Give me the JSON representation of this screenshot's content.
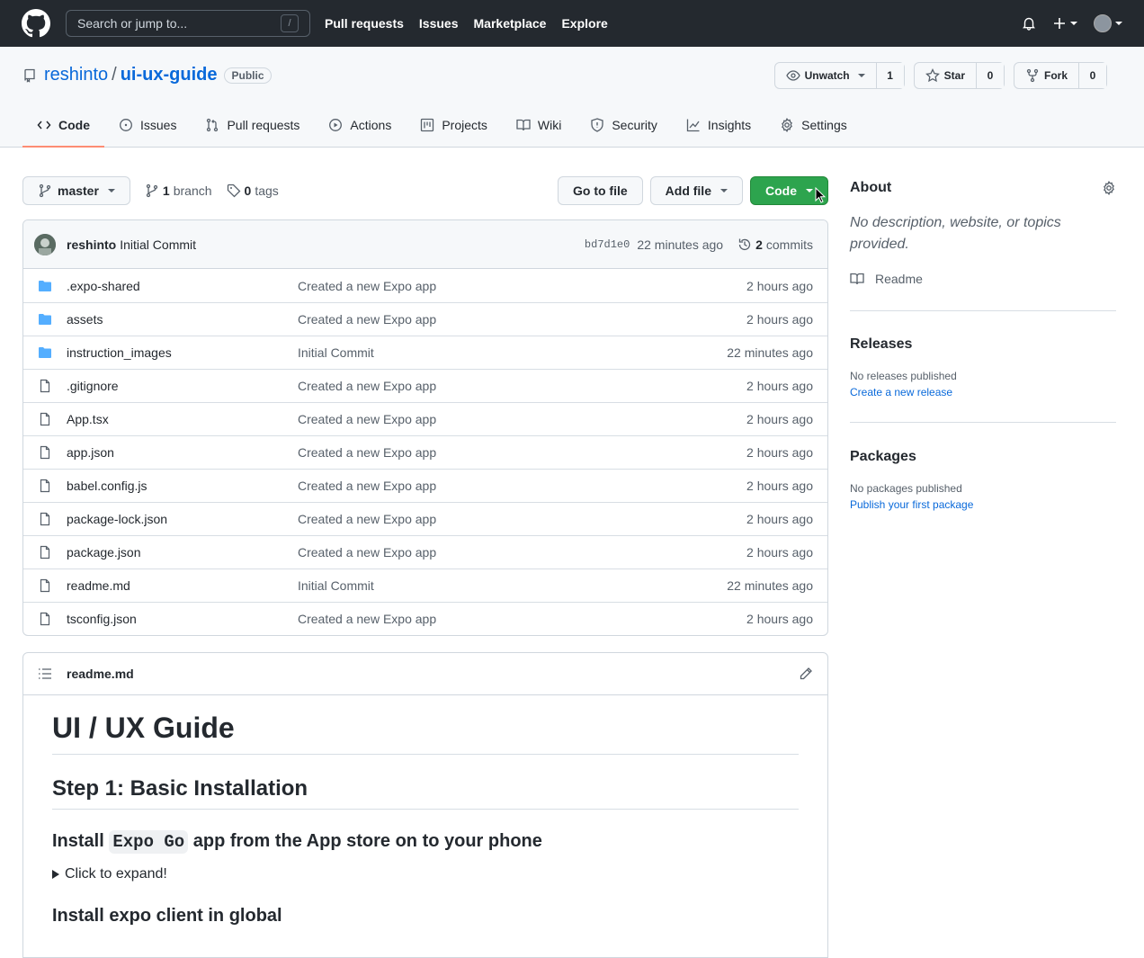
{
  "header": {
    "search_placeholder": "Search or jump to...",
    "search_shortcut": "/",
    "nav": [
      "Pull requests",
      "Issues",
      "Marketplace",
      "Explore"
    ]
  },
  "repo": {
    "owner": "reshinto",
    "separator": "/",
    "name": "ui-ux-guide",
    "visibility": "Public",
    "watch_label": "Unwatch",
    "watch_count": "1",
    "star_label": "Star",
    "star_count": "0",
    "fork_label": "Fork",
    "fork_count": "0",
    "tabs": [
      "Code",
      "Issues",
      "Pull requests",
      "Actions",
      "Projects",
      "Wiki",
      "Security",
      "Insights",
      "Settings"
    ]
  },
  "toolbar": {
    "branch": "master",
    "branch_count": "1",
    "branch_label": "branch",
    "tag_count": "0",
    "tag_label": "tags",
    "go_to_file": "Go to file",
    "add_file": "Add file",
    "code": "Code"
  },
  "commit": {
    "user": "reshinto",
    "message": "Initial Commit",
    "sha": "bd7d1e0",
    "time": "22 minutes ago",
    "count": "2",
    "count_label": "commits"
  },
  "files": [
    {
      "type": "folder",
      "name": ".expo-shared",
      "message": "Created a new Expo app",
      "age": "2 hours ago"
    },
    {
      "type": "folder",
      "name": "assets",
      "message": "Created a new Expo app",
      "age": "2 hours ago"
    },
    {
      "type": "folder",
      "name": "instruction_images",
      "message": "Initial Commit",
      "age": "22 minutes ago"
    },
    {
      "type": "file",
      "name": ".gitignore",
      "message": "Created a new Expo app",
      "age": "2 hours ago"
    },
    {
      "type": "file",
      "name": "App.tsx",
      "message": "Created a new Expo app",
      "age": "2 hours ago"
    },
    {
      "type": "file",
      "name": "app.json",
      "message": "Created a new Expo app",
      "age": "2 hours ago"
    },
    {
      "type": "file",
      "name": "babel.config.js",
      "message": "Created a new Expo app",
      "age": "2 hours ago"
    },
    {
      "type": "file",
      "name": "package-lock.json",
      "message": "Created a new Expo app",
      "age": "2 hours ago"
    },
    {
      "type": "file",
      "name": "package.json",
      "message": "Created a new Expo app",
      "age": "2 hours ago"
    },
    {
      "type": "file",
      "name": "readme.md",
      "message": "Initial Commit",
      "age": "22 minutes ago"
    },
    {
      "type": "file",
      "name": "tsconfig.json",
      "message": "Created a new Expo app",
      "age": "2 hours ago"
    }
  ],
  "readme": {
    "filename": "readme.md",
    "h1": "UI / UX Guide",
    "h2": "Step 1: Basic Installation",
    "h3a_pre": "Install",
    "h3a_code": "Expo Go",
    "h3a_post": "app from the App store on to your phone",
    "expand": "Click to expand!",
    "h3b": "Install expo client in global"
  },
  "sidebar": {
    "about_title": "About",
    "about_desc": "No description, website, or topics provided.",
    "readme_link": "Readme",
    "releases_title": "Releases",
    "releases_none": "No releases published",
    "releases_link": "Create a new release",
    "packages_title": "Packages",
    "packages_none": "No packages published",
    "packages_link": "Publish your first package"
  },
  "colors": {
    "header_bg": "#24292f",
    "link": "#0969da",
    "green": "#2da44e",
    "tab_underline": "#fd8c73",
    "folder": "#54aeff"
  }
}
